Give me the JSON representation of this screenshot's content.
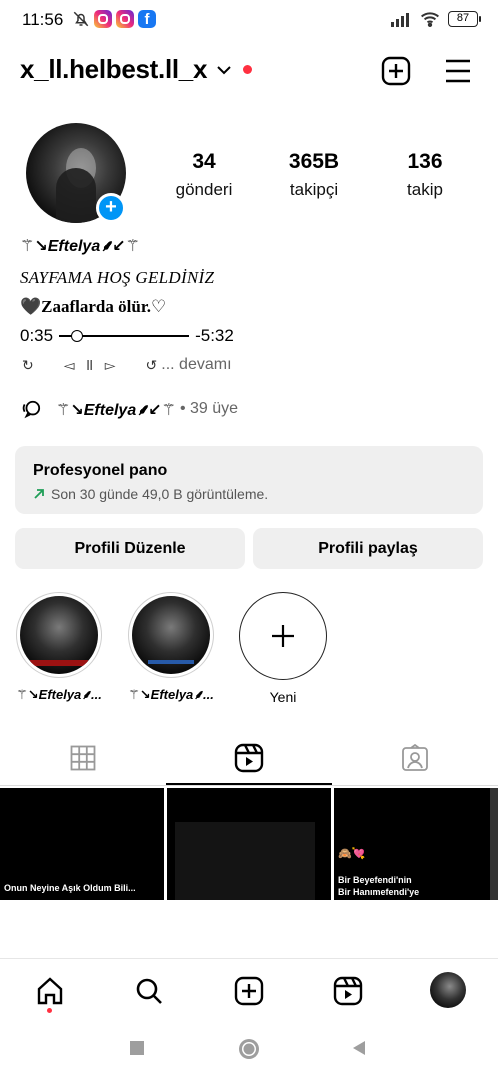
{
  "status_bar": {
    "time": "11:56",
    "battery": "87"
  },
  "header": {
    "username": "x_ll.helbest.ll_x"
  },
  "profile": {
    "stats": [
      {
        "value": "34",
        "label": "gönderi"
      },
      {
        "value": "365B",
        "label": "takipçi"
      },
      {
        "value": "136",
        "label": "takip"
      }
    ],
    "display_name": "⚚↘Eftelya⸙↙⚚",
    "bio_line1": "SAYFAMA HOŞ GELDİNİZ",
    "bio_line2": "🖤Zaaflаrda ölür.♡",
    "music": {
      "elapsed": "0:35",
      "remaining": "-5:32",
      "progress": 0.1
    },
    "controls": {
      "repeat": "↻",
      "prev": "◅",
      "pause": "ll",
      "next": "▻",
      "shuffle": "↺",
      "more": "... devamı"
    },
    "channel": {
      "name": "⚚↘Eftelya⸙↙⚚",
      "members": "• 39 üye"
    }
  },
  "dashboard": {
    "title": "Profesyonel pano",
    "subtitle": "Son 30 günde 49,0 B görüntüleme."
  },
  "buttons": {
    "edit": "Profili Düzenle",
    "share": "Profili paylaş"
  },
  "highlights": [
    {
      "label": "⚚↘Eftelya⸙..."
    },
    {
      "label": "⚚↘Eftelya⸙..."
    },
    {
      "label": "Yeni"
    }
  ],
  "posts": [
    {
      "text": "Onun Neyine Aşık Oldum Bili..."
    },
    {
      "text": ""
    },
    {
      "emoji": "🙈💘",
      "text": "Bir Beyefendi'nin\nBir Hanımefendi'ye"
    }
  ],
  "colors": {
    "accent": "#0095f6",
    "notification": "#ff3040",
    "trend": "#1f9e57"
  }
}
